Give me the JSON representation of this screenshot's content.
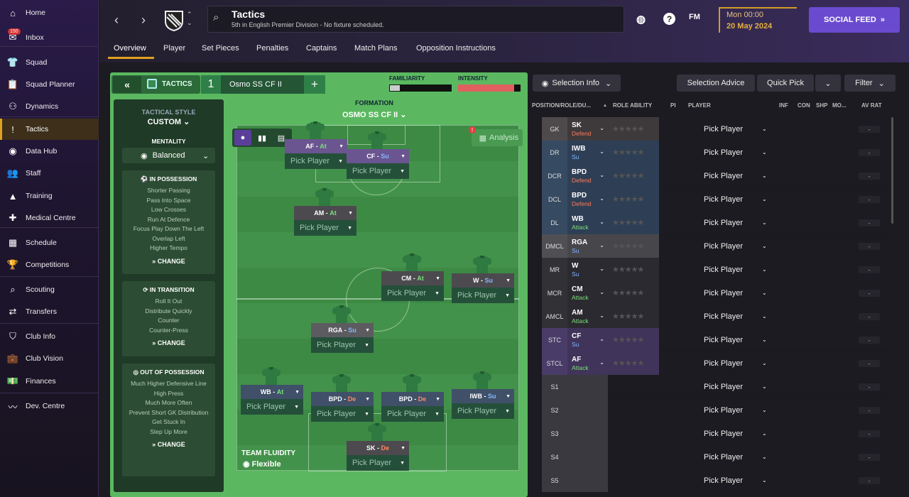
{
  "sidebar": {
    "items": [
      {
        "label": "Home",
        "icon": "home-icon",
        "glyph": "⌂"
      },
      {
        "label": "Inbox",
        "icon": "inbox-icon",
        "glyph": "✉",
        "badge": "150"
      },
      {
        "label": "Squad",
        "icon": "squad-icon",
        "glyph": "👕"
      },
      {
        "label": "Squad Planner",
        "icon": "clipboard-icon",
        "glyph": "📋"
      },
      {
        "label": "Dynamics",
        "icon": "dynamics-icon",
        "glyph": "⚇"
      },
      {
        "label": "Tactics",
        "icon": "tactics-icon",
        "glyph": "!"
      },
      {
        "label": "Data Hub",
        "icon": "data-hub-icon",
        "glyph": "◉"
      },
      {
        "label": "Staff",
        "icon": "staff-icon",
        "glyph": "👥"
      },
      {
        "label": "Training",
        "icon": "training-icon",
        "glyph": "▲"
      },
      {
        "label": "Medical Centre",
        "icon": "medical-icon",
        "glyph": "✚"
      },
      {
        "label": "Schedule",
        "icon": "calendar-icon",
        "glyph": "▦"
      },
      {
        "label": "Competitions",
        "icon": "trophy-icon",
        "glyph": "🏆"
      },
      {
        "label": "Scouting",
        "icon": "search-icon",
        "glyph": "⌕"
      },
      {
        "label": "Transfers",
        "icon": "transfers-icon",
        "glyph": "⇄"
      },
      {
        "label": "Club Info",
        "icon": "shield-icon",
        "glyph": "⛉"
      },
      {
        "label": "Club Vision",
        "icon": "briefcase-icon",
        "glyph": "💼"
      },
      {
        "label": "Finances",
        "icon": "finances-icon",
        "glyph": "💵"
      },
      {
        "label": "Dev. Centre",
        "icon": "dev-centre-icon",
        "glyph": "〰"
      }
    ]
  },
  "header": {
    "title": "Tactics",
    "subtitle": "5th in English Premier Division - No fixture scheduled.",
    "day": "Mon 00:00",
    "date": "20 May 2024",
    "social": "SOCIAL FEED",
    "fm": "FM"
  },
  "tabs": [
    "Overview",
    "Player",
    "Set Pieces",
    "Penalties",
    "Captains",
    "Match Plans",
    "Opposition Instructions"
  ],
  "tactics": {
    "label": "TACTICS",
    "slot": "1",
    "name": "Osmo SS CF II",
    "familiarity_label": "FAMILIARITY",
    "familiarity": 0.16,
    "intensity_label": "INTENSITY",
    "intensity": 0.9,
    "formation_label": "FORMATION",
    "formation_name": "OSMO SS CF II",
    "analysis": "Analysis",
    "fluidity_label": "TEAM FLUIDITY",
    "fluidity_value": "Flexible"
  },
  "style": {
    "label": "TACTICAL STYLE",
    "value": "CUSTOM",
    "mentality_label": "MENTALITY",
    "mentality_value": "Balanced",
    "change": "CHANGE",
    "in_possession": {
      "title": "IN POSSESSION",
      "items": [
        "Shorter Passing",
        "Pass Into Space",
        "Low Crosses",
        "Run At Defence",
        "Focus Play Down The Left",
        "Overlap Left",
        "Higher Tempo"
      ]
    },
    "in_transition": {
      "title": "IN TRANSITION",
      "items": [
        "Roll It Out",
        "Distribute Quickly",
        "Counter",
        "Counter-Press"
      ]
    },
    "out_possession": {
      "title": "OUT OF POSSESSION",
      "items": [
        "Much Higher Defensive Line",
        "High Press",
        "Much More Often",
        "Prevent Short GK Distribution",
        "Get Stuck In",
        "Step Up More"
      ]
    }
  },
  "pitch_players": [
    {
      "role": "AF",
      "duty": "At",
      "cls": "r-att",
      "pick": "Pick Player"
    },
    {
      "role": "CF",
      "duty": "Su",
      "cls": "r-att",
      "pick": "Pick Player"
    },
    {
      "role": "AM",
      "duty": "At",
      "cls": "r-def",
      "pick": "Pick Player"
    },
    {
      "role": "CM",
      "duty": "At",
      "cls": "r-def",
      "pick": "Pick Player"
    },
    {
      "role": "W",
      "duty": "Su",
      "cls": "r-def",
      "pick": "Pick Player"
    },
    {
      "role": "RGA",
      "duty": "Su",
      "cls": "r-mid",
      "pick": "Pick Player"
    },
    {
      "role": "WB",
      "duty": "At",
      "cls": "r-dl",
      "pick": "Pick Player"
    },
    {
      "role": "BPD",
      "duty": "De",
      "cls": "r-dl",
      "pick": "Pick Player"
    },
    {
      "role": "BPD",
      "duty": "De",
      "cls": "r-dl",
      "pick": "Pick Player"
    },
    {
      "role": "IWB",
      "duty": "Su",
      "cls": "r-dl",
      "pick": "Pick Player"
    },
    {
      "role": "SK",
      "duty": "De",
      "cls": "r-def",
      "pick": "Pick Player"
    }
  ],
  "right": {
    "selection_info": "Selection Info",
    "selection_advice": "Selection Advice",
    "quick_pick": "Quick Pick",
    "filter": "Filter",
    "columns": [
      "POSITION/ROLE/DU...",
      "ROLE ABILITY",
      "PI",
      "PLAYER",
      "INF",
      "CON",
      "SHP",
      "MO...",
      "AV RAT"
    ],
    "rows": [
      {
        "pos": "GK",
        "role": "SK",
        "duty": "Defend",
        "bg": "#4e4a4c",
        "rbg": "#3e3a3c",
        "dc": "#ff7a5a"
      },
      {
        "pos": "DR",
        "role": "IWB",
        "duty": "Su",
        "bg": "#364a62",
        "rbg": "#2e3f55",
        "dc": "#7fb8ff"
      },
      {
        "pos": "DCR",
        "role": "BPD",
        "duty": "Defend",
        "bg": "#364a62",
        "rbg": "#2e3f55",
        "dc": "#ff7a5a"
      },
      {
        "pos": "DCL",
        "role": "BPD",
        "duty": "Defend",
        "bg": "#364a62",
        "rbg": "#2e3f55",
        "dc": "#ff7a5a"
      },
      {
        "pos": "DL",
        "role": "WB",
        "duty": "Attack",
        "bg": "#364a62",
        "rbg": "#2e3f55",
        "dc": "#7be07b"
      },
      {
        "pos": "DMCL",
        "role": "RGA",
        "duty": "Su",
        "bg": "#505054",
        "rbg": "#47474b",
        "dc": "#7fb8ff"
      },
      {
        "pos": "MR",
        "role": "W",
        "duty": "Su",
        "bg": "#323136",
        "rbg": "#2b2a30",
        "dc": "#7fb8ff"
      },
      {
        "pos": "MCR",
        "role": "CM",
        "duty": "Attack",
        "bg": "#323136",
        "rbg": "#2b2a30",
        "dc": "#7be07b"
      },
      {
        "pos": "AMCL",
        "role": "AM",
        "duty": "Attack",
        "bg": "#323136",
        "rbg": "#2b2a30",
        "dc": "#7be07b"
      },
      {
        "pos": "STC",
        "role": "CF",
        "duty": "Su",
        "bg": "#4a3c68",
        "rbg": "#40345a",
        "dc": "#7fb8ff"
      },
      {
        "pos": "STCL",
        "role": "AF",
        "duty": "Attack",
        "bg": "#4a3c68",
        "rbg": "#40345a",
        "dc": "#7be07b"
      },
      {
        "pos": "S1",
        "role": "",
        "duty": "",
        "bg": "#3a393f",
        "rbg": "#3a393f",
        "dc": "#fff"
      },
      {
        "pos": "S2",
        "role": "",
        "duty": "",
        "bg": "#3a393f",
        "rbg": "#3a393f",
        "dc": "#fff"
      },
      {
        "pos": "S3",
        "role": "",
        "duty": "",
        "bg": "#3a393f",
        "rbg": "#3a393f",
        "dc": "#fff"
      },
      {
        "pos": "S4",
        "role": "",
        "duty": "",
        "bg": "#3a393f",
        "rbg": "#3a393f",
        "dc": "#fff"
      },
      {
        "pos": "S5",
        "role": "",
        "duty": "",
        "bg": "#3a393f",
        "rbg": "#3a393f",
        "dc": "#fff"
      }
    ],
    "pick_label": "Pick Player",
    "av_rat": "-"
  }
}
